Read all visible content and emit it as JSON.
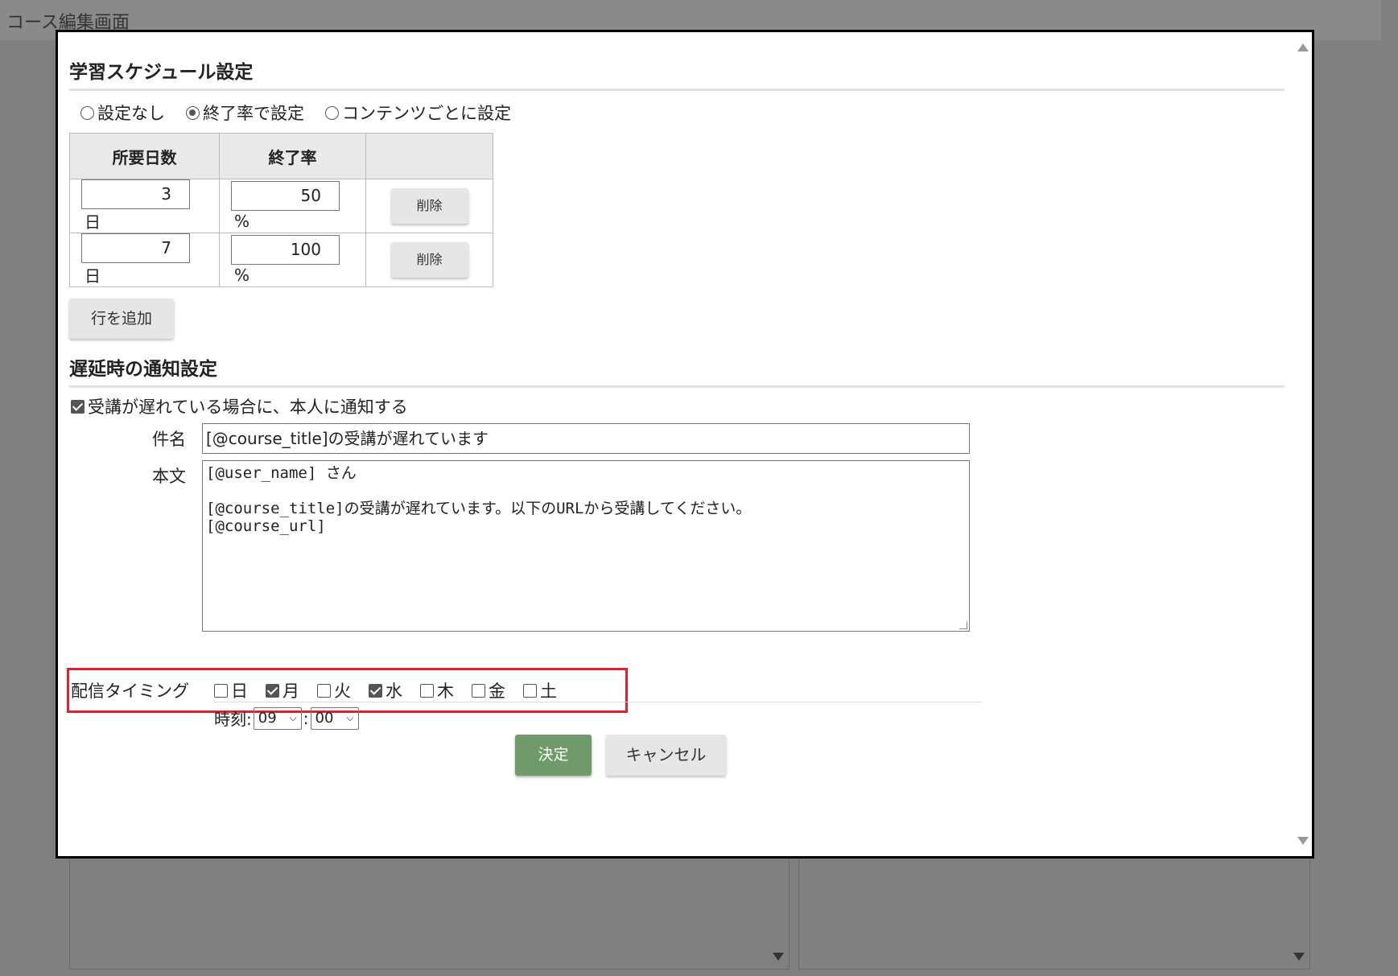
{
  "background": {
    "title": "コース編集画面"
  },
  "schedule": {
    "heading": "学習スケジュール設定",
    "options": [
      {
        "label": "設定なし",
        "selected": false
      },
      {
        "label": "終了率で設定",
        "selected": true
      },
      {
        "label": "コンテンツごとに設定",
        "selected": false
      }
    ],
    "columns": [
      "所要日数",
      "終了率",
      ""
    ],
    "rows": [
      {
        "days": "3",
        "day_unit": "日",
        "rate": "50",
        "rate_unit": "%",
        "delete_label": "削除"
      },
      {
        "days": "7",
        "day_unit": "日",
        "rate": "100",
        "rate_unit": "%",
        "delete_label": "削除"
      }
    ],
    "add_row_label": "行を追加"
  },
  "notification": {
    "heading": "遅延時の通知設定",
    "notify_label": "受講が遅れている場合に、本人に通知する",
    "notify_checked": true,
    "subject_label": "件名",
    "subject_value": "[@course_title]の受講が遅れています",
    "body_label": "本文",
    "body_value": "[@user_name] さん\n\n[@course_title]の受講が遅れています。以下のURLから受講してください。\n[@course_url]",
    "timing_label": "配信タイミング",
    "days": [
      {
        "label": "日",
        "checked": false
      },
      {
        "label": "月",
        "checked": true
      },
      {
        "label": "火",
        "checked": false
      },
      {
        "label": "水",
        "checked": true
      },
      {
        "label": "木",
        "checked": false
      },
      {
        "label": "金",
        "checked": false
      },
      {
        "label": "土",
        "checked": false
      }
    ],
    "time_label": "時刻:",
    "hour": "09",
    "separator": ":",
    "minute": "00"
  },
  "actions": {
    "confirm_label": "決定",
    "cancel_label": "キャンセル"
  },
  "colors": {
    "confirm": "#6f9a69",
    "highlight": "#e0202a"
  }
}
